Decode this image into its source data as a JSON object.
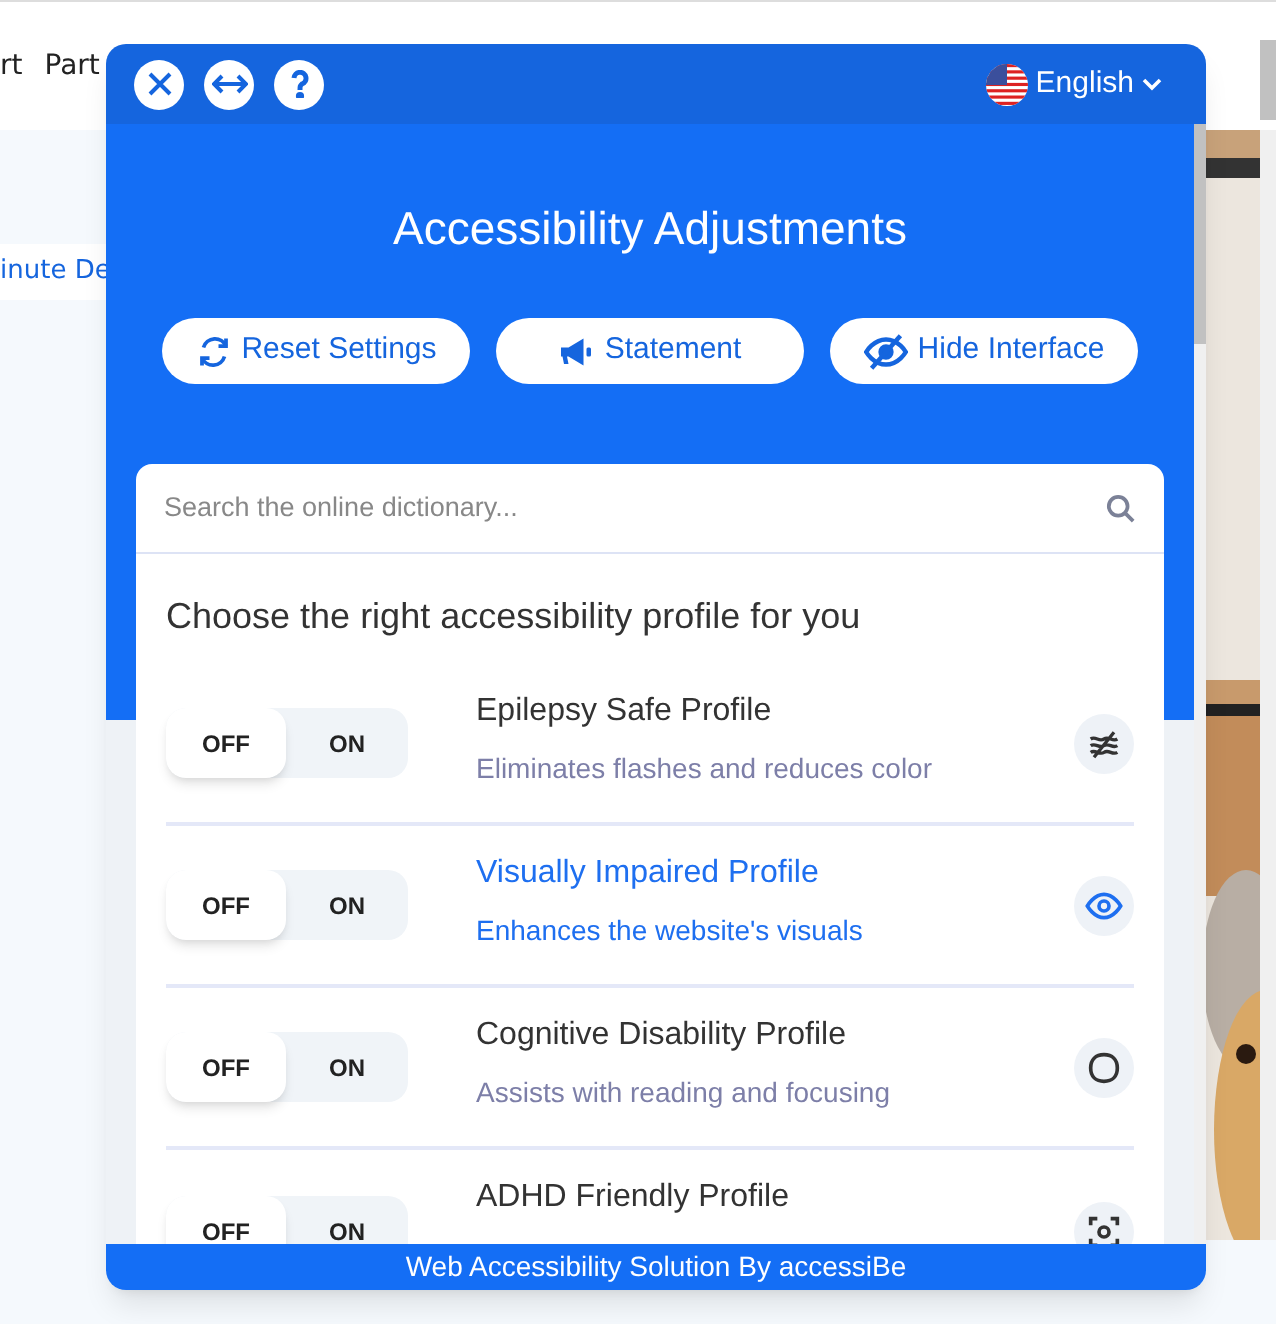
{
  "page": {
    "nav_items": [
      "rt",
      "Part"
    ],
    "tag": "inute De"
  },
  "widget": {
    "language": "English",
    "title": "Accessibility Adjustments",
    "actions": [
      {
        "label": "Reset Settings",
        "kind": "reset"
      },
      {
        "label": "Statement",
        "kind": "statement"
      },
      {
        "label": "Hide Interface",
        "kind": "hide"
      }
    ],
    "search": {
      "placeholder": "Search the online dictionary..."
    },
    "profiles_heading": "Choose the right accessibility profile for you",
    "profiles": [
      {
        "title": "Epilepsy Safe Profile",
        "description": "Eliminates flashes and reduces color",
        "kind": "waves",
        "on": false,
        "highlighted": false,
        "off_label": "OFF",
        "on_label": "ON"
      },
      {
        "title": "Visually Impaired Profile",
        "description": "Enhances the website's visuals",
        "kind": "eye",
        "on": false,
        "highlighted": true,
        "off_label": "OFF",
        "on_label": "ON"
      },
      {
        "title": "Cognitive Disability Profile",
        "description": "Assists with reading and focusing",
        "kind": "blob",
        "on": false,
        "highlighted": false,
        "off_label": "OFF",
        "on_label": "ON"
      },
      {
        "title": "ADHD Friendly Profile",
        "kind": "focus",
        "on": false,
        "highlighted": false,
        "off_label": "OFF",
        "on_label": "ON"
      }
    ],
    "footer": "Web Accessibility Solution By accessiBe"
  }
}
